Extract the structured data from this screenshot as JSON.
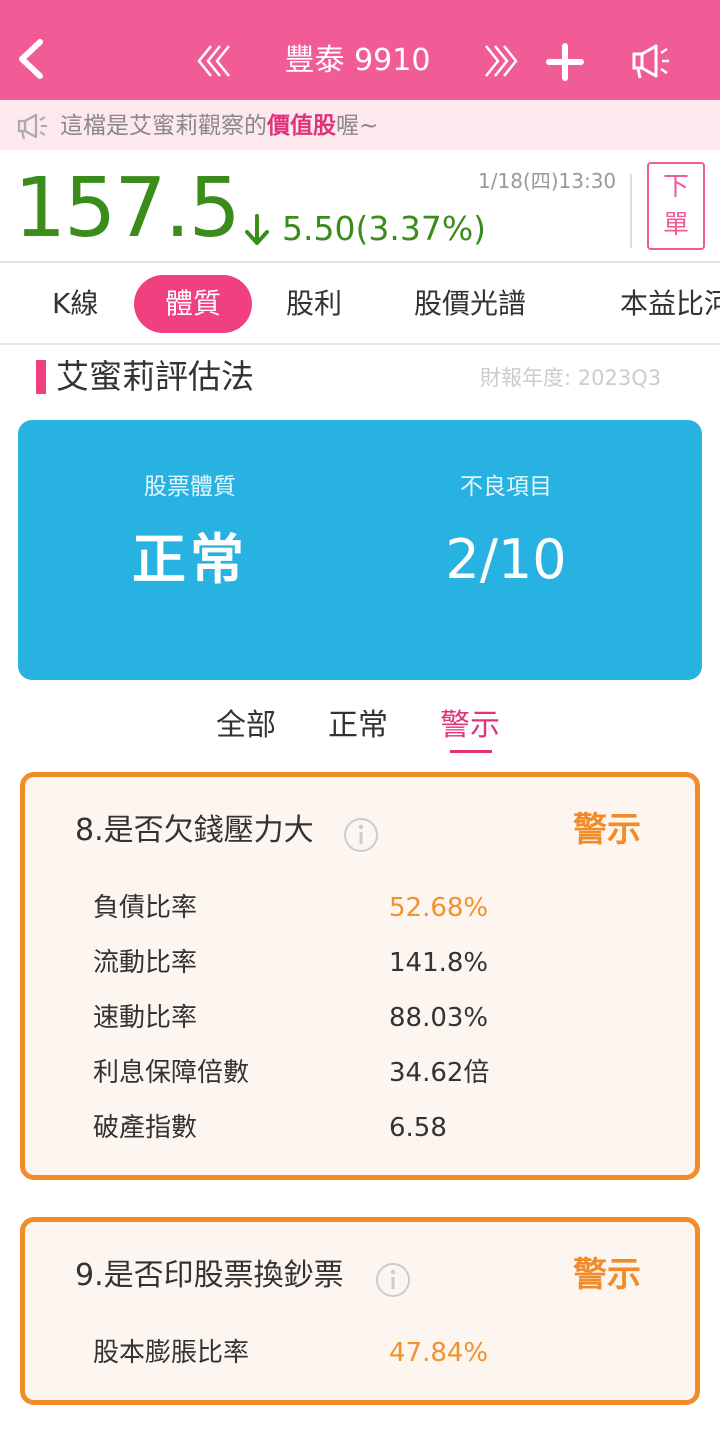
{
  "header": {
    "title": "豐泰 9910",
    "prev_icon": "double-chevron-left-icon",
    "next_icon": "double-chevron-right-icon",
    "add_icon": "plus-icon",
    "speaker_icon": "megaphone-icon",
    "bg_color": "#f25c96"
  },
  "notice": {
    "prefix": "這檔是艾蜜莉觀察的",
    "highlight": "價值股",
    "suffix": "喔~"
  },
  "quote": {
    "price": "157.5",
    "change": "5.50(3.37%)",
    "direction": "down",
    "time": "1/18(四)13:30",
    "order_line1": "下",
    "order_line2": "單",
    "down_color": "#3a8c1b"
  },
  "tabs": [
    {
      "label": "K線",
      "active": false
    },
    {
      "label": "體質",
      "active": true
    },
    {
      "label": "股利",
      "active": false
    },
    {
      "label": "股價光譜",
      "active": false
    },
    {
      "label": "本益比河",
      "active": false
    }
  ],
  "section": {
    "title": "艾蜜莉評估法",
    "fiscal": "財報年度: 2023Q3"
  },
  "summary": {
    "health_label": "股票體質",
    "health_value": "正常",
    "bad_label": "不良項目",
    "bad_value": "2/10",
    "bg_color": "#28b2e2"
  },
  "filters": {
    "all": "全部",
    "normal": "正常",
    "warning": "警示",
    "active": "警示"
  },
  "cards": [
    {
      "title": "8.是否欠錢壓力大",
      "status": "警示",
      "rows": [
        {
          "label": "負債比率",
          "value": "52.68%",
          "warn": true
        },
        {
          "label": "流動比率",
          "value": "141.8%",
          "warn": false
        },
        {
          "label": "速動比率",
          "value": "88.03%",
          "warn": false
        },
        {
          "label": "利息保障倍數",
          "value": "34.62倍",
          "warn": false
        },
        {
          "label": "破產指數",
          "value": "6.58",
          "warn": false
        }
      ]
    },
    {
      "title": "9.是否印股票換鈔票",
      "status": "警示",
      "rows": [
        {
          "label": "股本膨脹比率",
          "value": "47.84%",
          "warn": true
        }
      ]
    }
  ],
  "colors": {
    "accent_pink": "#f0407f",
    "warning_orange": "#f28c28"
  }
}
